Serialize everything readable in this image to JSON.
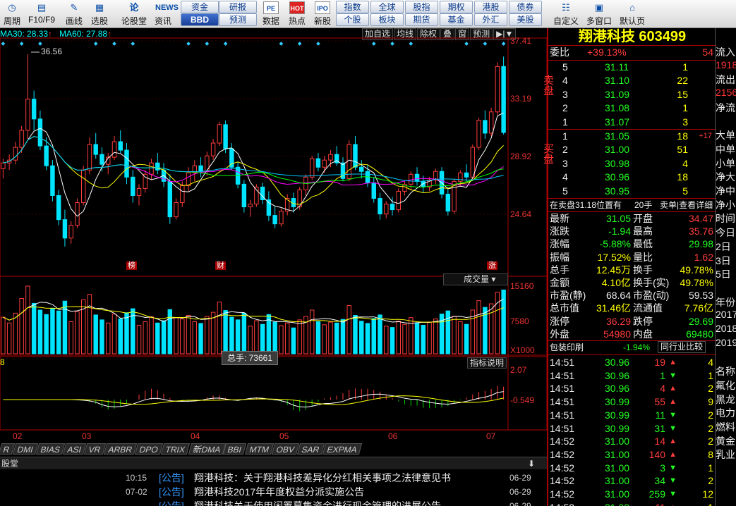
{
  "toolbar": {
    "buttons": [
      {
        "label": "周期",
        "icon": "clock-icon",
        "glyph": "◷"
      },
      {
        "label": "F10/F9",
        "icon": "f10-icon",
        "glyph": "▤"
      },
      {
        "label": "画线",
        "icon": "pencil-icon",
        "glyph": "✎"
      },
      {
        "label": "选股",
        "icon": "filter-icon",
        "glyph": "▦"
      },
      {
        "label": "论股堂",
        "icon": "discussion-icon",
        "glyph": "论"
      },
      {
        "label": "资讯",
        "icon": "news-icon",
        "glyph": "NEWS"
      }
    ],
    "mid": [
      {
        "label": "资金",
        "active": false
      },
      {
        "label": "研报",
        "active": false
      },
      {
        "label": "BBD",
        "active": true
      },
      {
        "label": "预测",
        "active": false
      }
    ],
    "buttons2": [
      {
        "label": "数据",
        "icon": "pe-icon",
        "glyph": "PE"
      },
      {
        "label": "热点",
        "icon": "hot-icon",
        "glyph": "HOT"
      },
      {
        "label": "新股",
        "icon": "ipo-icon",
        "glyph": "IPO"
      }
    ],
    "grid": [
      [
        "指数",
        "全球",
        "股指",
        "期权",
        "港股",
        "债券"
      ],
      [
        "个股",
        "板块",
        "期货",
        "基金",
        "外汇",
        "美股"
      ]
    ],
    "right": [
      {
        "label": "自定义",
        "icon": "custom-icon",
        "glyph": "☷"
      },
      {
        "label": "多窗口",
        "icon": "multi-window-icon",
        "glyph": "▣"
      },
      {
        "label": "默认页",
        "icon": "home-icon",
        "glyph": "⌂"
      }
    ]
  },
  "ma_bar": {
    "ma30": "MA30: 28.33",
    "ma60": "MA60: 27.88",
    "arrow": "↑"
  },
  "chart_ctrls": [
    "加自选",
    "均线",
    "除权",
    "叠",
    "窗",
    "预测",
    "▶|▼"
  ],
  "chart_data": {
    "type": "candlestick",
    "price_axis": [
      "37.41",
      "33.19",
      "28.92",
      "24.64"
    ],
    "volume_axis": [
      "15160",
      "7580",
      "X1000"
    ],
    "indicator_axis": [
      "2.07",
      "-0.549"
    ],
    "month_labels": [
      "02",
      "03",
      "04",
      "05",
      "06",
      "07"
    ],
    "high_marker": "36.56",
    "tags": [
      "榜",
      "财",
      "涨"
    ],
    "volume_label": "成交量",
    "indicator_label": "指标说明",
    "tooltip": "总手: 73661",
    "indicator_prefix": "8",
    "ohlc": [
      [
        28.5,
        29.2,
        27.8,
        28.9
      ],
      [
        28.9,
        29.5,
        28.4,
        29.1
      ],
      [
        29.1,
        30.4,
        28.8,
        30.0
      ],
      [
        30.0,
        31.5,
        29.6,
        31.2
      ],
      [
        31.2,
        36.56,
        30.6,
        33.4
      ],
      [
        33.4,
        34.0,
        31.2,
        32.0
      ],
      [
        32.0,
        32.6,
        29.8,
        30.1
      ],
      [
        30.1,
        30.7,
        28.4,
        28.7
      ],
      [
        28.7,
        29.1,
        26.2,
        26.6
      ],
      [
        26.6,
        27.0,
        24.5,
        24.9
      ],
      [
        24.9,
        25.6,
        23.0,
        23.6
      ],
      [
        23.6,
        24.8,
        23.2,
        24.5
      ],
      [
        24.5,
        26.4,
        24.3,
        26.1
      ],
      [
        26.1,
        28.7,
        25.9,
        28.4
      ],
      [
        28.4,
        30.7,
        28.1,
        30.2
      ],
      [
        30.2,
        31.0,
        29.2,
        29.5
      ],
      [
        29.5,
        30.0,
        28.3,
        28.8
      ],
      [
        28.8,
        29.6,
        28.1,
        29.3
      ],
      [
        29.3,
        30.8,
        29.1,
        30.4
      ],
      [
        30.4,
        31.2,
        29.6,
        29.8
      ],
      [
        29.8,
        30.3,
        27.4,
        27.9
      ],
      [
        27.9,
        28.4,
        26.1,
        26.6
      ],
      [
        26.6,
        27.4,
        25.9,
        27.1
      ],
      [
        27.1,
        28.4,
        26.8,
        28.1
      ],
      [
        28.1,
        29.2,
        27.7,
        28.9
      ],
      [
        28.9,
        29.6,
        28.1,
        28.4
      ],
      [
        28.4,
        28.9,
        27.2,
        27.6
      ],
      [
        27.6,
        28.1,
        24.6,
        25.1
      ],
      [
        25.1,
        26.4,
        24.9,
        26.1
      ],
      [
        26.1,
        27.6,
        25.8,
        27.3
      ],
      [
        27.3,
        28.6,
        26.9,
        28.2
      ],
      [
        28.2,
        29.1,
        27.6,
        28.7
      ],
      [
        28.7,
        29.3,
        27.9,
        28.3
      ],
      [
        28.3,
        29.7,
        28.0,
        29.4
      ],
      [
        29.4,
        30.6,
        29.1,
        30.3
      ],
      [
        30.3,
        31.8,
        30.1,
        31.6
      ],
      [
        31.6,
        31.9,
        29.6,
        29.9
      ],
      [
        29.9,
        30.3,
        28.4,
        28.6
      ],
      [
        28.6,
        29.0,
        27.1,
        27.4
      ],
      [
        27.4,
        27.7,
        25.4,
        25.8
      ],
      [
        25.8,
        26.3,
        25.1,
        26.0
      ],
      [
        26.0,
        27.4,
        25.8,
        27.2
      ],
      [
        27.2,
        27.5,
        26.0,
        26.3
      ],
      [
        26.3,
        26.9,
        24.8,
        25.2
      ],
      [
        25.2,
        25.8,
        24.3,
        24.6
      ],
      [
        24.6,
        25.7,
        24.4,
        25.5
      ],
      [
        25.5,
        26.7,
        25.2,
        26.4
      ],
      [
        26.4,
        26.8,
        25.4,
        25.8
      ],
      [
        25.8,
        27.2,
        25.6,
        27.0
      ],
      [
        27.0,
        28.1,
        26.6,
        27.9
      ],
      [
        27.9,
        29.4,
        27.7,
        29.2
      ],
      [
        29.2,
        29.6,
        28.3,
        28.6
      ],
      [
        28.6,
        29.4,
        28.2,
        29.1
      ],
      [
        29.1,
        29.8,
        28.6,
        29.5
      ],
      [
        29.5,
        30.1,
        28.7,
        28.9
      ],
      [
        28.9,
        29.3,
        27.6,
        27.8
      ],
      [
        27.8,
        30.5,
        27.6,
        30.2
      ],
      [
        30.2,
        30.8,
        28.4,
        28.6
      ],
      [
        28.6,
        29.1,
        27.8,
        28.3
      ],
      [
        28.3,
        28.8,
        27.2,
        27.5
      ],
      [
        27.5,
        27.9,
        26.1,
        26.4
      ],
      [
        26.4,
        26.8,
        24.9,
        25.3
      ],
      [
        25.3,
        26.2,
        25.0,
        26.0
      ],
      [
        26.0,
        26.5,
        25.2,
        25.6
      ],
      [
        25.6,
        27.1,
        25.4,
        26.9
      ],
      [
        26.9,
        27.6,
        26.6,
        27.4
      ],
      [
        27.4,
        28.3,
        27.0,
        28.1
      ],
      [
        28.1,
        28.6,
        27.3,
        27.6
      ],
      [
        27.6,
        28.0,
        26.8,
        27.2
      ],
      [
        27.2,
        27.9,
        26.9,
        27.7
      ],
      [
        27.7,
        28.5,
        27.4,
        28.3
      ],
      [
        28.3,
        28.6,
        26.4,
        26.7
      ],
      [
        26.7,
        27.2,
        25.2,
        25.5
      ],
      [
        25.5,
        27.8,
        25.3,
        27.6
      ],
      [
        27.6,
        28.4,
        27.3,
        28.2
      ],
      [
        28.2,
        28.8,
        27.6,
        27.9
      ],
      [
        27.9,
        30.2,
        27.7,
        30.0
      ],
      [
        30.0,
        32.1,
        29.8,
        31.9
      ],
      [
        31.9,
        32.6,
        30.6,
        31.0
      ],
      [
        31.0,
        32.8,
        30.8,
        32.5
      ],
      [
        32.5,
        36.0,
        32.3,
        35.7
      ],
      [
        35.7,
        36.4,
        30.9,
        31.05
      ]
    ],
    "volume": [
      8200,
      6900,
      9100,
      12400,
      15160,
      11300,
      9800,
      8800,
      10200,
      9600,
      11800,
      7200,
      9400,
      12100,
      13300,
      8700,
      7600,
      6900,
      8900,
      7800,
      9200,
      10100,
      6400,
      7200,
      8300,
      6900,
      7400,
      9900,
      8100,
      7800,
      8600,
      7200,
      6800,
      8400,
      9300,
      11600,
      9700,
      8200,
      7600,
      9100,
      6200,
      7400,
      6600,
      8800,
      7100,
      6300,
      6900,
      5800,
      7600,
      8400,
      9800,
      7200,
      6500,
      7100,
      6900,
      7700,
      10800,
      8600,
      7300,
      6800,
      7900,
      8700,
      6200,
      5900,
      7300,
      6600,
      8100,
      6900,
      6400,
      7100,
      7800,
      8900,
      9600,
      8400,
      7200,
      6600,
      9800,
      11900,
      10400,
      11200,
      13800,
      14300
    ]
  },
  "right_panel": {
    "title": "翔港科技 603499",
    "weibi": {
      "label": "委比",
      "value": "+39.13%",
      "diff": "54"
    },
    "sell_side": "卖盘",
    "buy_side": "买盘",
    "asks": [
      {
        "lv": "5",
        "price": "31.11",
        "vol": "1"
      },
      {
        "lv": "4",
        "price": "31.10",
        "vol": "22"
      },
      {
        "lv": "3",
        "price": "31.09",
        "vol": "15"
      },
      {
        "lv": "2",
        "price": "31.08",
        "vol": "1"
      },
      {
        "lv": "1",
        "price": "31.07",
        "vol": "3"
      }
    ],
    "bids": [
      {
        "lv": "1",
        "price": "31.05",
        "vol": "18",
        "chg": "+17"
      },
      {
        "lv": "2",
        "price": "31.00",
        "vol": "51",
        "chg": ""
      },
      {
        "lv": "3",
        "price": "30.98",
        "vol": "4",
        "chg": ""
      },
      {
        "lv": "4",
        "price": "30.96",
        "vol": "18",
        "chg": ""
      },
      {
        "lv": "5",
        "price": "30.95",
        "vol": "5",
        "chg": ""
      }
    ],
    "notice": {
      "text": "在卖盘31.18位置有",
      "count": "20手",
      "link": "卖单|查看详细"
    },
    "stats": [
      [
        "最新",
        "31.05",
        "开盘",
        "34.47"
      ],
      [
        "涨跌",
        "-1.94",
        "最高",
        "35.76"
      ],
      [
        "涨幅",
        "-5.88%",
        "最低",
        "29.98"
      ],
      [
        "振幅",
        "17.52%",
        "量比",
        "1.62"
      ],
      [
        "总手",
        "12.45万",
        "换手",
        "49.78%"
      ],
      [
        "金额",
        "4.10亿",
        "换手(实)",
        "49.78%"
      ],
      [
        "市盈(静)",
        "68.64",
        "市盈(动)",
        "59.53"
      ],
      [
        "总市值",
        "31.46亿",
        "流通值",
        "7.76亿"
      ],
      [
        "涨停",
        "36.29",
        "跌停",
        "29.69"
      ],
      [
        "外盘",
        "54980",
        "内盘",
        "69480"
      ]
    ],
    "stat_colors": [
      [
        "wht",
        "green",
        "wht",
        "red"
      ],
      [
        "wht",
        "green",
        "wht",
        "red"
      ],
      [
        "wht",
        "green",
        "wht",
        "green"
      ],
      [
        "wht",
        "yel",
        "wht",
        "red"
      ],
      [
        "wht",
        "yel",
        "wht",
        "yel"
      ],
      [
        "wht",
        "yel",
        "wht",
        "yel"
      ],
      [
        "wht",
        "wht",
        "wht",
        "wht"
      ],
      [
        "wht",
        "yel",
        "wht",
        "yel"
      ],
      [
        "wht",
        "red",
        "wht",
        "green"
      ],
      [
        "wht",
        "red",
        "wht",
        "green"
      ]
    ],
    "sub": {
      "left": "包装印刷",
      "mid": "-1.94%",
      "right": "同行业比较"
    },
    "ticks": [
      [
        "14:51",
        "30.96",
        "19",
        "up",
        "4"
      ],
      [
        "14:51",
        "30.96",
        "1",
        "down",
        "1"
      ],
      [
        "14:51",
        "30.96",
        "4",
        "up",
        "2"
      ],
      [
        "14:51",
        "30.99",
        "55",
        "up",
        "9"
      ],
      [
        "14:51",
        "30.99",
        "11",
        "down",
        "2"
      ],
      [
        "14:51",
        "30.99",
        "31",
        "down",
        "2"
      ],
      [
        "14:52",
        "31.00",
        "14",
        "up",
        "2"
      ],
      [
        "14:52",
        "31.00",
        "140",
        "up",
        "8"
      ],
      [
        "14:52",
        "31.00",
        "3",
        "down",
        "1"
      ],
      [
        "14:52",
        "31.00",
        "34",
        "down",
        "2"
      ],
      [
        "14:52",
        "31.00",
        "259",
        "down",
        "12"
      ],
      [
        "14:52",
        "31.08",
        "11",
        "up",
        "1"
      ]
    ]
  },
  "far_right": {
    "items": [
      "流入",
      "1918",
      "流出",
      "2156",
      "净流",
      "",
      "大单",
      "中单",
      "小单",
      "净大",
      "净中",
      "净小",
      "时间",
      "今日",
      "2日",
      "3日",
      "5日",
      "",
      "年份",
      "2017",
      "2018",
      "2019",
      "",
      "名称",
      "氟化",
      "黑龙",
      "电力",
      "燃料",
      "黄金",
      "乳业"
    ]
  },
  "indicator_tabs": [
    "R",
    "DMI",
    "BIAS",
    "ASI",
    "VR",
    "ARBR",
    "DPO",
    "TRIX",
    "新DMA",
    "BBI",
    "MTM",
    "OBV",
    "SAR",
    "EXPMA"
  ],
  "news": {
    "header": "股堂",
    "rows": [
      {
        "time": "10:15",
        "tag": "[公告]",
        "title": "翔港科技：关于翔港科技差异化分红相关事项之法律意见书",
        "date": "06-29"
      },
      {
        "time": "07-02",
        "tag": "[公告]",
        "title": "翔港科技2017年年度权益分派实施公告",
        "date": "06-29"
      },
      {
        "time": "",
        "tag": "[公告]",
        "title": "翔港科技关于使用闲置募集资金进行现金管理的进展公告",
        "date": "06-29"
      }
    ]
  }
}
